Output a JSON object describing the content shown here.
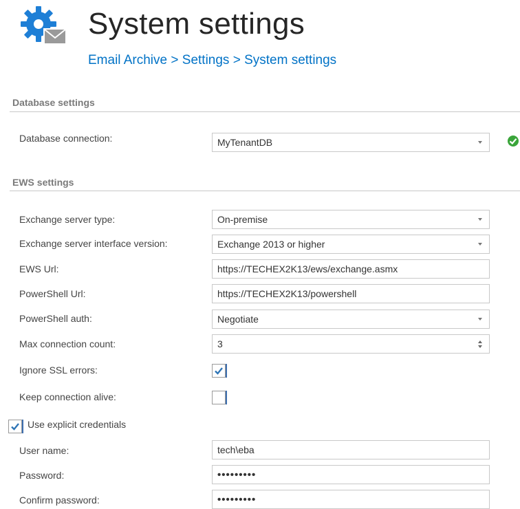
{
  "header": {
    "title": "System settings",
    "breadcrumb": [
      "Email Archive",
      "Settings",
      "System settings"
    ],
    "separator": ">"
  },
  "database": {
    "section_title": "Database settings",
    "connection_label": "Database connection:",
    "connection_value": "MyTenantDB",
    "status_icon": "check-circle-icon"
  },
  "ews": {
    "section_title": "EWS settings",
    "server_type_label": "Exchange server type:",
    "server_type_value": "On-premise",
    "interface_version_label": "Exchange server interface version:",
    "interface_version_value": "Exchange 2013 or higher",
    "ews_url_label": "EWS Url:",
    "ews_url_value": "https://TECHEX2K13/ews/exchange.asmx",
    "powershell_url_label": "PowerShell Url:",
    "powershell_url_value": "https://TECHEX2K13/powershell",
    "powershell_auth_label": "PowerShell auth:",
    "powershell_auth_value": "Negotiate",
    "max_conn_label": "Max connection count:",
    "max_conn_value": "3",
    "ignore_ssl_label": "Ignore SSL errors:",
    "ignore_ssl_checked": true,
    "keep_alive_label": "Keep connection alive:",
    "keep_alive_checked": false
  },
  "credentials": {
    "use_explicit_label": "Use explicit credentials",
    "use_explicit_checked": true,
    "username_label": "User name:",
    "username_value": "tech\\eba",
    "password_label": "Password:",
    "password_value": "•••••••••",
    "confirm_label": "Confirm password:",
    "confirm_value": "•••••••••"
  },
  "colors": {
    "link": "#0072c6",
    "check": "#2e75b6",
    "status_ok": "#3aa53a"
  }
}
